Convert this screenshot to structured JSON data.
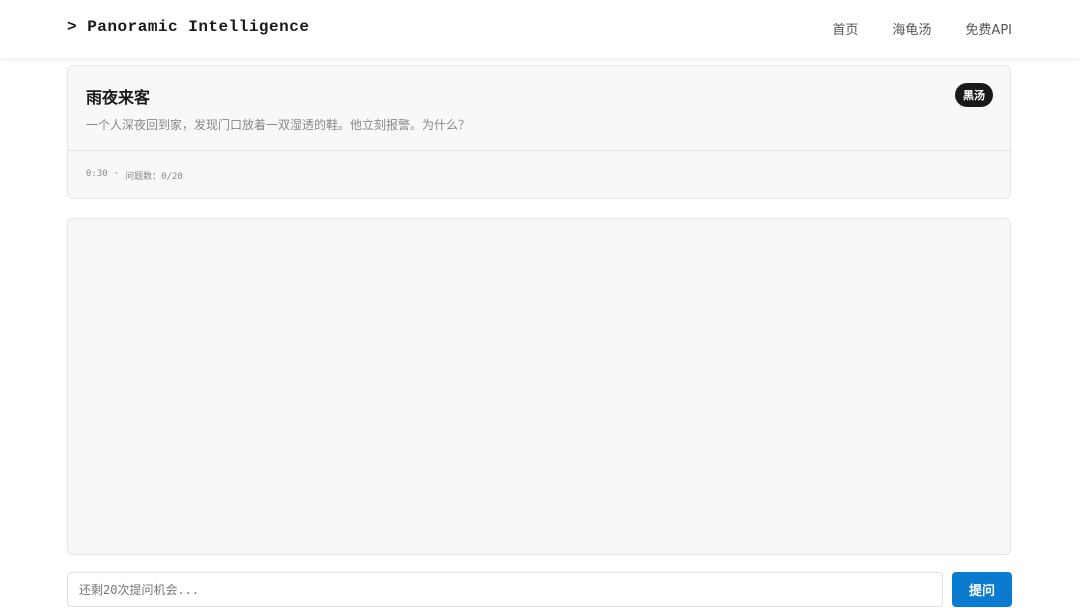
{
  "header": {
    "brand": "> Panoramic Intelligence",
    "nav": [
      {
        "label": "首页"
      },
      {
        "label": "海龟汤"
      },
      {
        "label": "免费API"
      }
    ]
  },
  "puzzle": {
    "title": "雨夜来客",
    "badge": "黑汤",
    "description": "一个人深夜回到家，发现门口放着一双湿透的鞋。他立刻报警。为什么？",
    "timer": "0:30",
    "separator": "·",
    "question_count": "问题数：0/20"
  },
  "input": {
    "placeholder": "还剩20次提问机会..."
  },
  "actions": {
    "ask_label": "提问"
  },
  "colors": {
    "accent": "#0a7bd1",
    "badge_bg": "#1a1a1a",
    "panel_bg": "#f7f8fa"
  }
}
